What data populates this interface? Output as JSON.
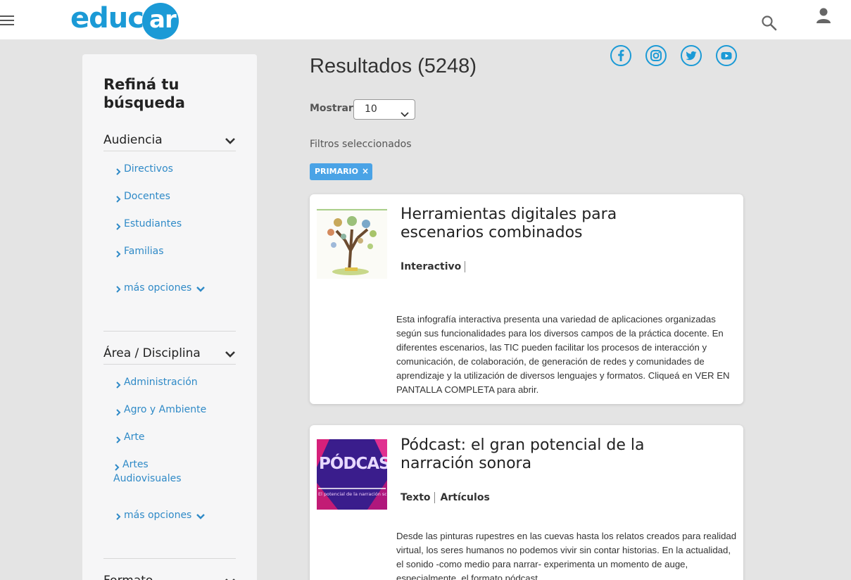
{
  "header": {
    "logo_text": "educ",
    "logo_badge": "ar",
    "menu_icon": "hamburger-icon",
    "search_icon": "search-icon",
    "user_icon": "user-icon"
  },
  "sidebar": {
    "title": "Refiná tu búsqueda",
    "sections": [
      {
        "label": "Audiencia",
        "items": [
          "Directivos",
          "Docentes",
          "Estudiantes",
          "Familias"
        ],
        "more": "más opciones"
      },
      {
        "label": "Área / Disciplina",
        "items": [
          "Administración",
          "Agro y Ambiente",
          "Arte",
          "Artes Audiovisuales"
        ],
        "more": "más opciones"
      },
      {
        "label": "Formato"
      }
    ]
  },
  "main": {
    "results_title": "Resultados (5248)",
    "show_label": "Mostrar",
    "show_value": "10",
    "filters_label": "Filtros seleccionados",
    "filter_chip": "PRIMARIO",
    "filter_chip_remove": "×",
    "social": [
      "facebook-icon",
      "instagram-icon",
      "twitter-icon",
      "youtube-icon"
    ],
    "results": [
      {
        "title": "Herramientas digitales para escenarios combinados",
        "tags": [
          "Interactivo"
        ],
        "description": "Esta infografía interactiva presenta una variedad de aplicaciones organizadas según sus funcionalidades para los diversos campos de la práctica docente. En diferentes escenarios, las TIC pueden facilitar los procesos de interacción y comunicación, de colaboración, de generación de redes y comunidades de aprendizaje y la utilización de diversos lenguajes y formatos. Cliqueá en VER EN PANTALLA COMPLETA para abrir."
      },
      {
        "title": "Pódcast: el gran potencial de la narración sonora",
        "tags": [
          "Texto",
          "Artículos"
        ],
        "thumb_text": "PÓDCAST",
        "thumb_subtext": "El potencial de la narración sonora",
        "description": "Desde las pinturas rupestres en las cuevas hasta los relatos creados para realidad virtual, los seres humanos no podemos vivir sin contar historias. En la actualidad, el sonido -como medio para narrar- experimenta un momento de auge, especialmente, el formato pódcast."
      }
    ]
  },
  "colors": {
    "brand": "#1b9ad6",
    "link": "#2f8ac7",
    "chip": "#4aa3e6",
    "background": "#e4e4e4"
  }
}
